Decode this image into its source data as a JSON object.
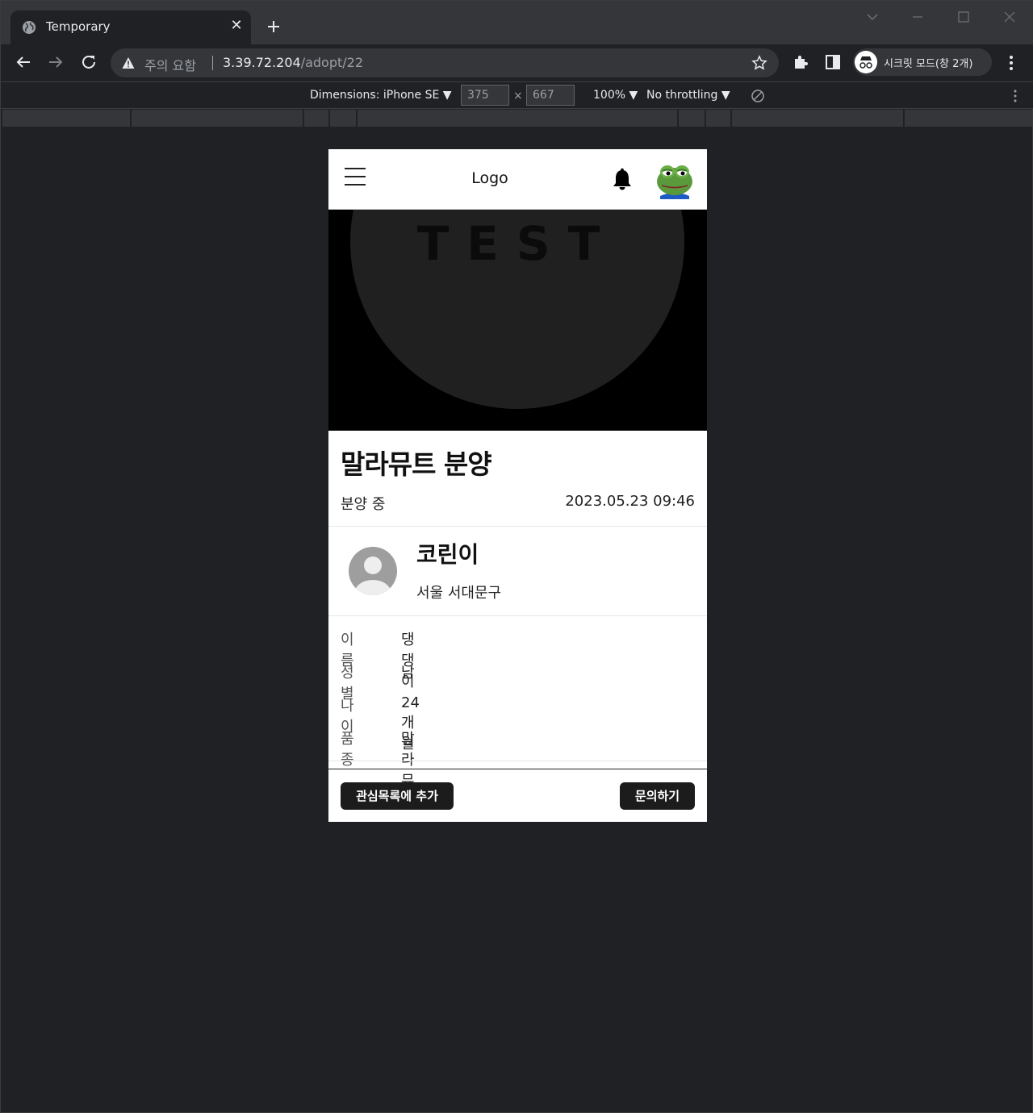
{
  "browser": {
    "tab_title": "Temporary",
    "tab_close": "✕",
    "security_warning": "주의 요함",
    "url_host": "3.39.72.204",
    "url_path": "/adopt/22",
    "incognito_label": "시크릿 모드(창 2개)"
  },
  "devtools": {
    "dimensions_label": "Dimensions: iPhone SE ▼",
    "width": "375",
    "height": "667",
    "times": "×",
    "zoom": "100% ▼",
    "throttling": "No throttling ▼"
  },
  "app": {
    "logo": "Logo",
    "hero_text": "TEST",
    "post_title": "말라뮤트 분양",
    "status": "분양 중",
    "date": "2023.05.23 09:46",
    "writer": {
      "name": "코린이",
      "location": "서울 서대문구"
    },
    "details": [
      {
        "key": "이름",
        "value": "댕댕이"
      },
      {
        "key": "성별",
        "value": "남"
      },
      {
        "key": "나이",
        "value": "24개월"
      },
      {
        "key": "품종",
        "value": "말라뮤트"
      }
    ],
    "buttons": {
      "wishlist": "관심목록에 추가",
      "inquiry": "문의하기"
    }
  },
  "colors": {
    "browser_frame": "#35363a",
    "page_bg": "#202124",
    "button_bg": "#1c1c1c"
  }
}
